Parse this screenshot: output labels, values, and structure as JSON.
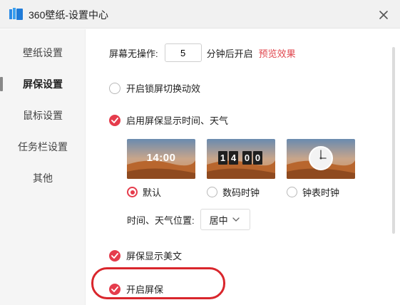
{
  "window": {
    "title": "360壁纸-设置中心"
  },
  "sidebar": {
    "items": [
      {
        "label": "壁纸设置"
      },
      {
        "label": "屏保设置"
      },
      {
        "label": "鼠标设置"
      },
      {
        "label": "任务栏设置"
      },
      {
        "label": "其他"
      }
    ],
    "active_index": 1
  },
  "settings": {
    "idle": {
      "prefix": "屏幕无操作:",
      "value": "5",
      "suffix": "分钟后开启",
      "preview_link": "预览效果"
    },
    "lock_animation": {
      "label": "开启锁屏切换动效",
      "checked": false
    },
    "show_time_weather": {
      "label": "启用屏保显示时间、天气",
      "checked": true
    },
    "clock_styles": [
      {
        "label": "默认",
        "selected": true,
        "preview_text": "14:00"
      },
      {
        "label": "数码时钟",
        "selected": false,
        "digits": [
          "1",
          "4",
          "0",
          "0"
        ]
      },
      {
        "label": "钟表时钟",
        "selected": false
      }
    ],
    "position": {
      "label": "时间、天气位置:",
      "value": "居中"
    },
    "show_quotes": {
      "label": "屏保显示美文",
      "checked": true
    },
    "enable_screensaver": {
      "label": "开启屏保",
      "checked": true
    }
  },
  "colors": {
    "accent": "#e53c4c",
    "link": "#e0464d",
    "annotation": "#d9262c"
  }
}
